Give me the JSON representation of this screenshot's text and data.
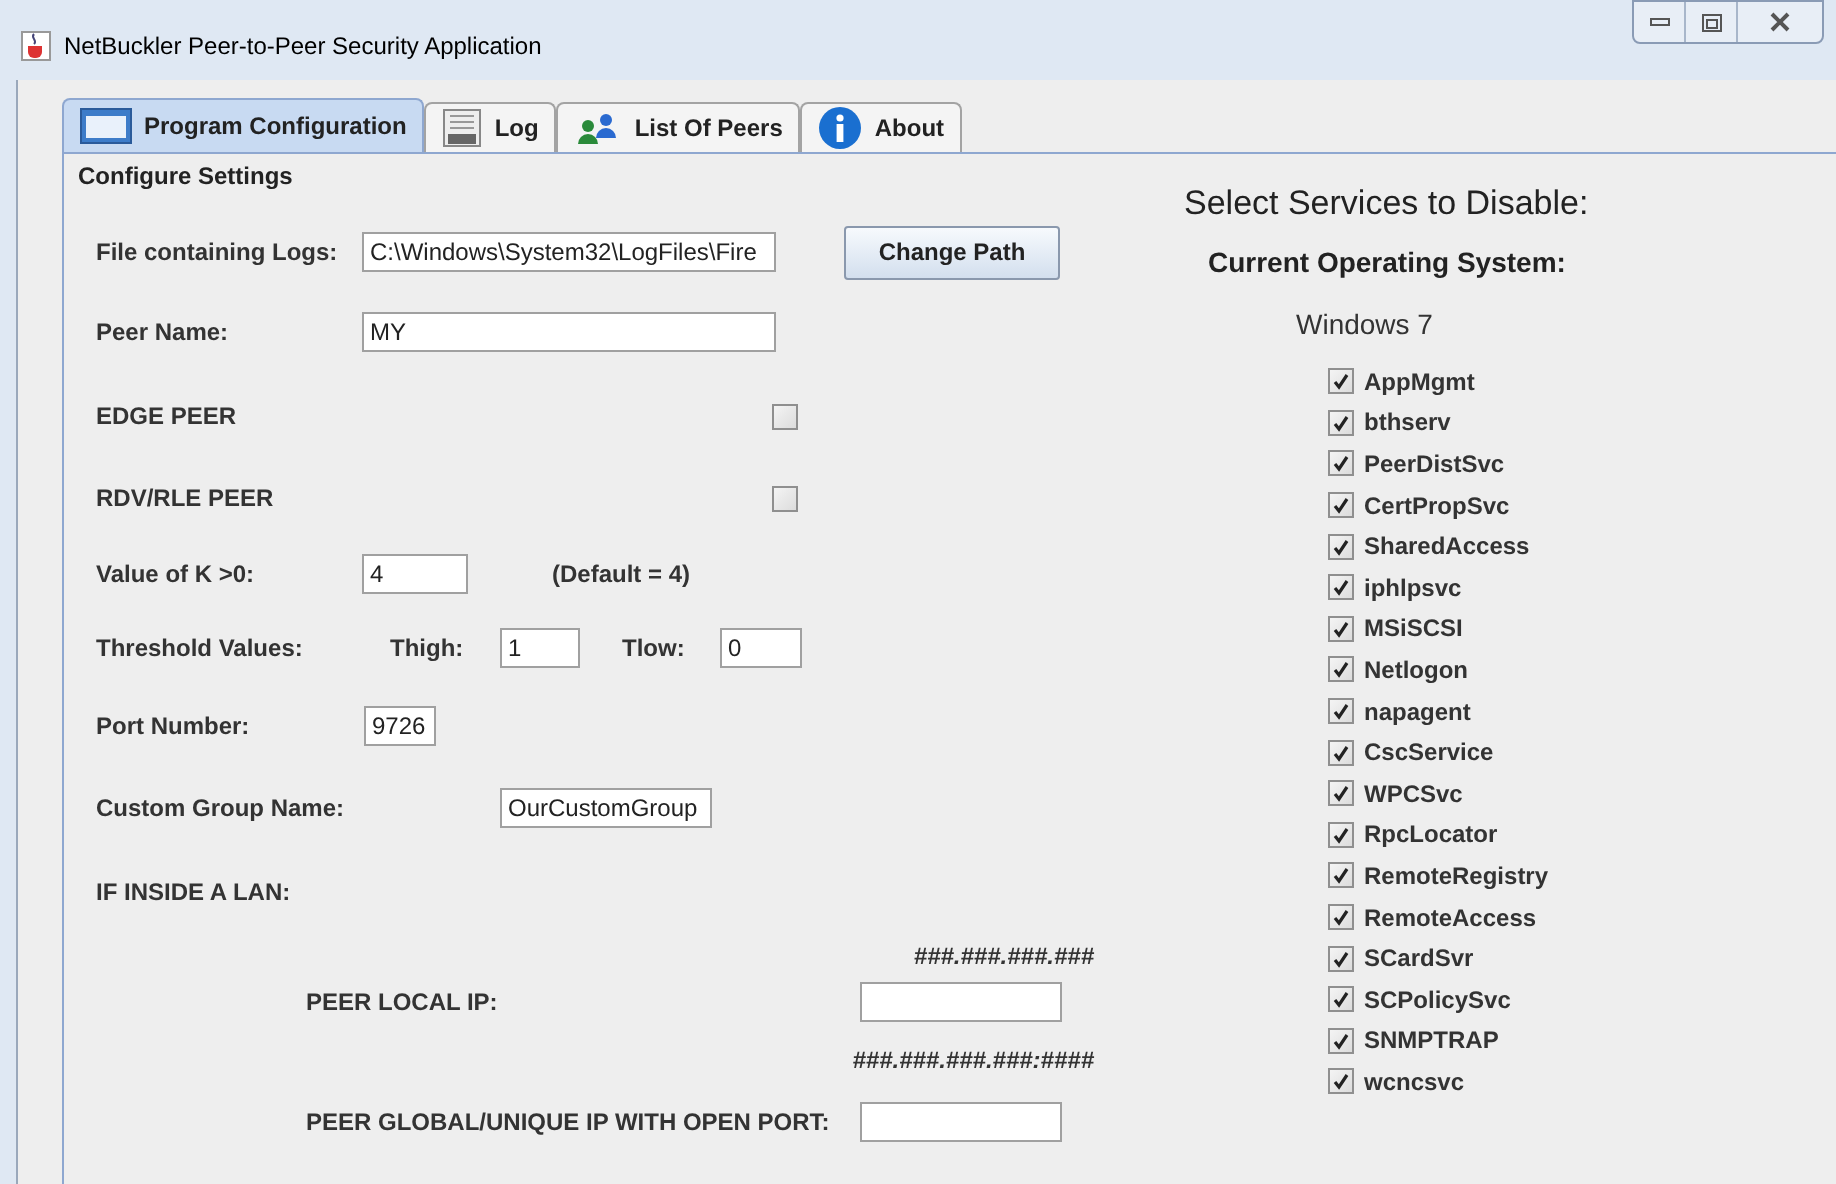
{
  "window": {
    "title": "NetBuckler Peer-to-Peer Security Application"
  },
  "tabs": [
    {
      "label": "Program Configuration",
      "selected": true,
      "kind": "window"
    },
    {
      "label": "Log",
      "selected": false,
      "kind": "log"
    },
    {
      "label": "List Of Peers",
      "selected": false,
      "kind": "peers"
    },
    {
      "label": "About",
      "selected": false,
      "kind": "info"
    }
  ],
  "panel": {
    "title": "Configure Settings"
  },
  "form": {
    "log_file": {
      "label": "File containing Logs:",
      "value": "C:\\Windows\\System32\\LogFiles\\Fire"
    },
    "change_path_button": "Change Path",
    "peer_name": {
      "label": "Peer Name:",
      "value": "MY"
    },
    "edge_peer": {
      "label": "EDGE PEER",
      "checked": false
    },
    "rdv_peer": {
      "label": "RDV/RLE PEER",
      "checked": false
    },
    "k": {
      "label": "Value of K >0:",
      "value": "4",
      "note": "(Default = 4)"
    },
    "threshold": {
      "label": "Threshold Values:",
      "high_label": "Thigh:",
      "high_value": "1",
      "low_label": "Tlow:",
      "low_value": "0"
    },
    "port": {
      "label": "Port Number:",
      "value": "9726"
    },
    "group": {
      "label": "Custom Group Name:",
      "value": "OurCustomGroup"
    },
    "lan": {
      "label": "IF INSIDE A LAN:",
      "local_format": "###.###.###.###",
      "local_label": "PEER LOCAL IP:",
      "global_format": "###.###.###.###:####",
      "global_label": "PEER GLOBAL/UNIQUE IP WITH OPEN PORT:"
    }
  },
  "services": {
    "heading": "Select Services to Disable:",
    "os_label": "Current Operating System:",
    "os_value": "Windows 7",
    "items": [
      {
        "label": "AppMgmt",
        "checked": true
      },
      {
        "label": "bthserv",
        "checked": true
      },
      {
        "label": "PeerDistSvc",
        "checked": true
      },
      {
        "label": "CertPropSvc",
        "checked": true
      },
      {
        "label": "SharedAccess",
        "checked": true
      },
      {
        "label": "iphlpsvc",
        "checked": true
      },
      {
        "label": "MSiSCSI",
        "checked": true
      },
      {
        "label": "Netlogon",
        "checked": true
      },
      {
        "label": "napagent",
        "checked": true
      },
      {
        "label": "CscService",
        "checked": true
      },
      {
        "label": "WPCSvc",
        "checked": true
      },
      {
        "label": "RpcLocator",
        "checked": true
      },
      {
        "label": "RemoteRegistry",
        "checked": true
      },
      {
        "label": "RemoteAccess",
        "checked": true
      },
      {
        "label": "SCardSvr",
        "checked": true
      },
      {
        "label": "SCPolicySvc",
        "checked": true
      },
      {
        "label": "SNMPTRAP",
        "checked": true
      },
      {
        "label": "wcncsvc",
        "checked": true
      }
    ]
  }
}
